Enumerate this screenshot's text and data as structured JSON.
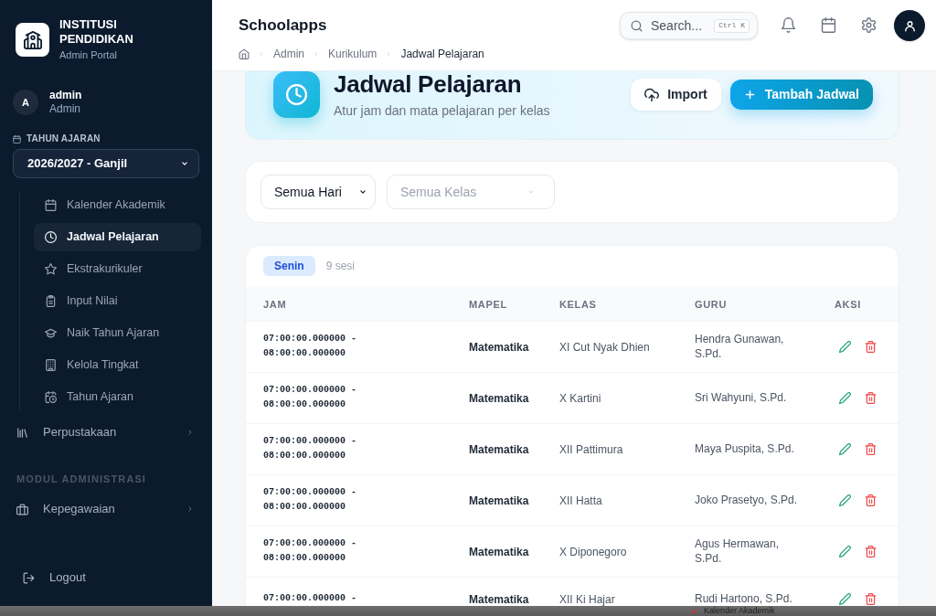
{
  "sidebar": {
    "brand": {
      "title": "INSTITUSI PENDIDIKAN",
      "subtitle": "Admin Portal"
    },
    "user": {
      "initial": "A",
      "name": "admin",
      "role": "Admin"
    },
    "year_selector": {
      "label": "TAHUN AJARAN",
      "value": "2026/2027 - Ganjil"
    },
    "submenu": [
      {
        "label": "Kalender Akademik",
        "selected": false
      },
      {
        "label": "Jadwal Pelajaran",
        "selected": true
      },
      {
        "label": "Ekstrakurikuler",
        "selected": false
      },
      {
        "label": "Input Nilai",
        "selected": false
      },
      {
        "label": "Naik Tahun Ajaran",
        "selected": false
      },
      {
        "label": "Kelola Tingkat",
        "selected": false
      },
      {
        "label": "Tahun Ajaran",
        "selected": false
      }
    ],
    "menu": [
      {
        "label": "Perpustakaan"
      }
    ],
    "section_title": "MODUL ADMINISTRASI",
    "admin_menu": [
      {
        "label": "Kepegawaian"
      }
    ],
    "logout": "Logout"
  },
  "header": {
    "title": "Schoolapps",
    "breadcrumb": [
      {
        "label": "Admin",
        "current": false
      },
      {
        "label": "Kurikulum",
        "current": false
      },
      {
        "label": "Jadwal Pelajaran",
        "current": true
      }
    ],
    "search": {
      "placeholder": "Search...",
      "shortcut": "Ctrl K"
    }
  },
  "page_header": {
    "title": "Jadwal Pelajaran",
    "subtitle": "Atur jam dan mata pelajaran per kelas",
    "buttons": [
      {
        "label": "Import",
        "kind": "secondary"
      },
      {
        "label": "Tambah Jadwal",
        "kind": "primary"
      }
    ]
  },
  "filters": [
    {
      "value": "Semua Hari"
    },
    {
      "placeholder": "Semua Kelas"
    }
  ],
  "schedule": {
    "day": "Senin",
    "count": "9 sesi",
    "columns": [
      "JAM",
      "MAPEL",
      "KELAS",
      "GURU",
      "AKSI"
    ],
    "rows": [
      {
        "jam": "07:00:00.000000 - 08:00:00.000000",
        "mapel": "Matematika",
        "kelas": "XI Cut Nyak Dhien",
        "guru": "Hendra Gunawan, S.Pd."
      },
      {
        "jam": "07:00:00.000000 - 08:00:00.000000",
        "mapel": "Matematika",
        "kelas": "X Kartini",
        "guru": "Sri Wahyuni, S.Pd."
      },
      {
        "jam": "07:00:00.000000 - 08:00:00.000000",
        "mapel": "Matematika",
        "kelas": "XII Pattimura",
        "guru": "Maya Puspita, S.Pd."
      },
      {
        "jam": "07:00:00.000000 - 08:00:00.000000",
        "mapel": "Matematika",
        "kelas": "XII Hatta",
        "guru": "Joko Prasetyo, S.Pd."
      },
      {
        "jam": "07:00:00.000000 - 08:00:00.000000",
        "mapel": "Matematika",
        "kelas": "X Diponegoro",
        "guru": "Agus Hermawan, S.Pd."
      },
      {
        "jam": "07:00:00.000000 -",
        "mapel": "Matematika",
        "kelas": "XII Ki Hajar",
        "guru": "Rudi Hartono, S.Pd."
      }
    ]
  },
  "bottom_overlay": {
    "label": "Kalender Akademik"
  }
}
